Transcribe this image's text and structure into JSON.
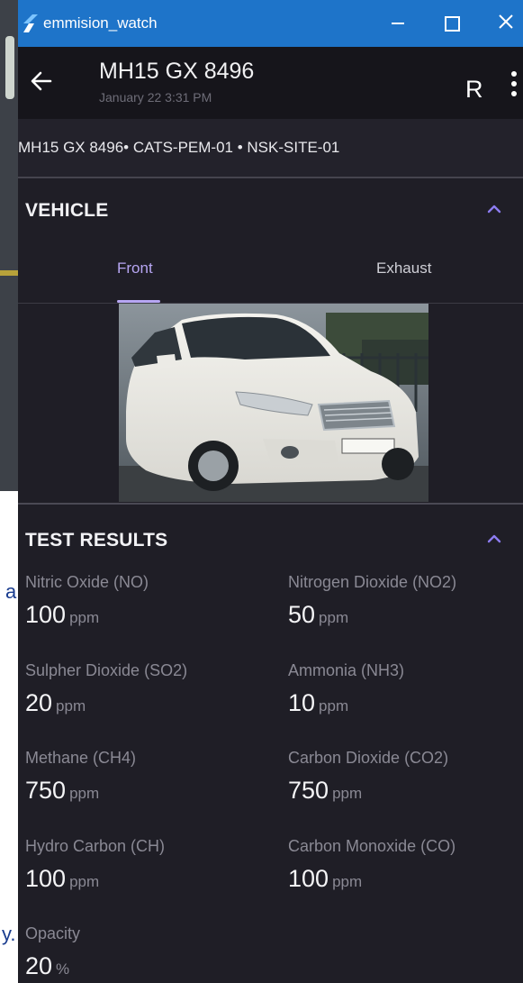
{
  "window": {
    "title": "emmision_watch"
  },
  "appbar": {
    "plate": "MH15 GX 8496",
    "subtitle": "January 22 3:31 PM",
    "avatar_letter": "R"
  },
  "infoline": "MH15 GX 8496• CATS-PEM-01 • NSK-SITE-01",
  "vehicle": {
    "section_title": "VEHICLE",
    "tabs": [
      {
        "label": "Front",
        "active": true
      },
      {
        "label": "Exhaust",
        "active": false
      }
    ]
  },
  "background_fragments": [
    "a",
    "y."
  ],
  "test_results": {
    "section_title": "TEST RESULTS",
    "metrics": [
      {
        "label": "Nitric Oxide (NO)",
        "value": "100",
        "unit": "ppm"
      },
      {
        "label": "Nitrogen Dioxide (NO2)",
        "value": "50",
        "unit": "ppm"
      },
      {
        "label": "Sulpher Dioxide (SO2)",
        "value": "20",
        "unit": "ppm"
      },
      {
        "label": "Ammonia (NH3)",
        "value": "10",
        "unit": "ppm"
      },
      {
        "label": "Methane (CH4)",
        "value": "750",
        "unit": "ppm"
      },
      {
        "label": "Carbon Dioxide (CO2)",
        "value": "750",
        "unit": "ppm"
      },
      {
        "label": "Hydro Carbon (CH)",
        "value": "100",
        "unit": "ppm"
      },
      {
        "label": "Carbon Monoxide (CO)",
        "value": "100",
        "unit": "ppm"
      },
      {
        "label": "Opacity",
        "value": "20",
        "unit": "%"
      }
    ]
  },
  "colors": {
    "titlebar": "#1e74c9",
    "accent": "#b7a6f3",
    "background": "#1f1e26"
  },
  "icons": [
    "app-logo-icon",
    "minimize-icon",
    "maximize-icon",
    "close-icon",
    "back-arrow-icon",
    "more-vertical-icon",
    "chevron-up-icon"
  ]
}
